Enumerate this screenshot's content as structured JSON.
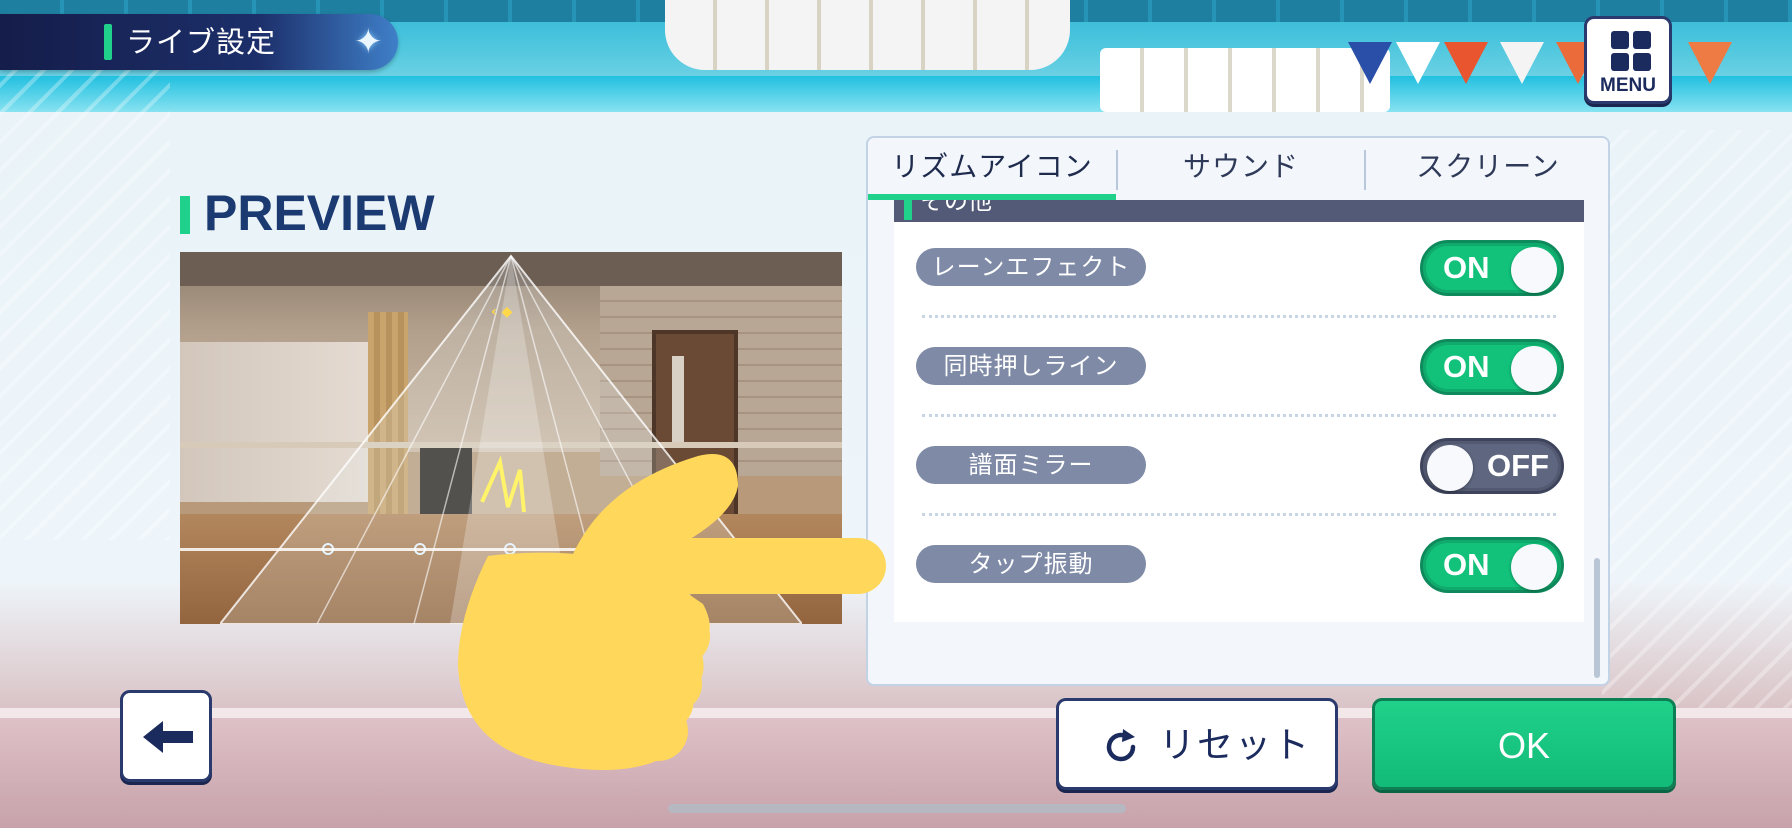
{
  "header": {
    "title": "ライブ設定"
  },
  "menu": {
    "label": "MENU"
  },
  "preview": {
    "title": "PREVIEW"
  },
  "tabs": [
    {
      "label": "リズムアイコン",
      "active": true
    },
    {
      "label": "サウンド",
      "active": false
    },
    {
      "label": "スクリーン",
      "active": false
    }
  ],
  "section": {
    "title": "その他"
  },
  "settings": [
    {
      "label": "レーンエフェクト",
      "state": "ON"
    },
    {
      "label": "同時押しライン",
      "state": "ON"
    },
    {
      "label": "譜面ミラー",
      "state": "OFF"
    },
    {
      "label": "タップ振動",
      "state": "ON"
    }
  ],
  "buttons": {
    "reset": "リセット",
    "ok": "OK"
  },
  "colors": {
    "accent_green": "#1fd18a",
    "navy": "#1c2b5e",
    "toggle_on": "#12c27b",
    "toggle_off": "#5f6680",
    "hand": "#ffd75a"
  },
  "icons": {
    "menu": "grid-icon",
    "back": "arrow-left-icon",
    "reset": "refresh-icon",
    "pointer": "pointing-hand-icon"
  }
}
